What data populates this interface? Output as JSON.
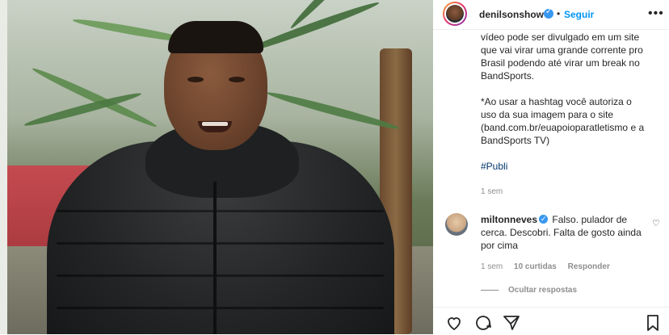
{
  "post": {
    "owner": {
      "username": "denilsonshow",
      "separator": "•",
      "follow_label": "Seguir",
      "more_icon": "more-horizontal-icon"
    },
    "caption": {
      "lines": [
        "vídeo pode ser divulgado em um site",
        "que vai virar uma grande corrente pro",
        "Brasil podendo até virar um break no",
        "BandSports.",
        "",
        "*Ao usar a hashtag você autoriza o",
        "uso da sua imagem para o site",
        "(band.com.br/euapoioparatletismo e a",
        "BandSports TV)"
      ],
      "hashtag": "#Publi",
      "time": "1 sem"
    },
    "comment": {
      "username": "miltonneves",
      "text": "Falso. pulador de cerca. Descobri. Falta de gosto ainda por cima",
      "time": "1 sem",
      "likes": "10 curtidas",
      "reply_label": "Responder",
      "hide_replies_label": "Ocultar respostas"
    },
    "actions": {
      "like_icon": "heart-icon",
      "comment_icon": "comment-icon",
      "share_icon": "send-icon",
      "save_icon": "bookmark-icon"
    }
  },
  "colors": {
    "link": "#0095f6",
    "verified": "#3897f0",
    "muted": "#8e8e8e",
    "text": "#262626"
  }
}
